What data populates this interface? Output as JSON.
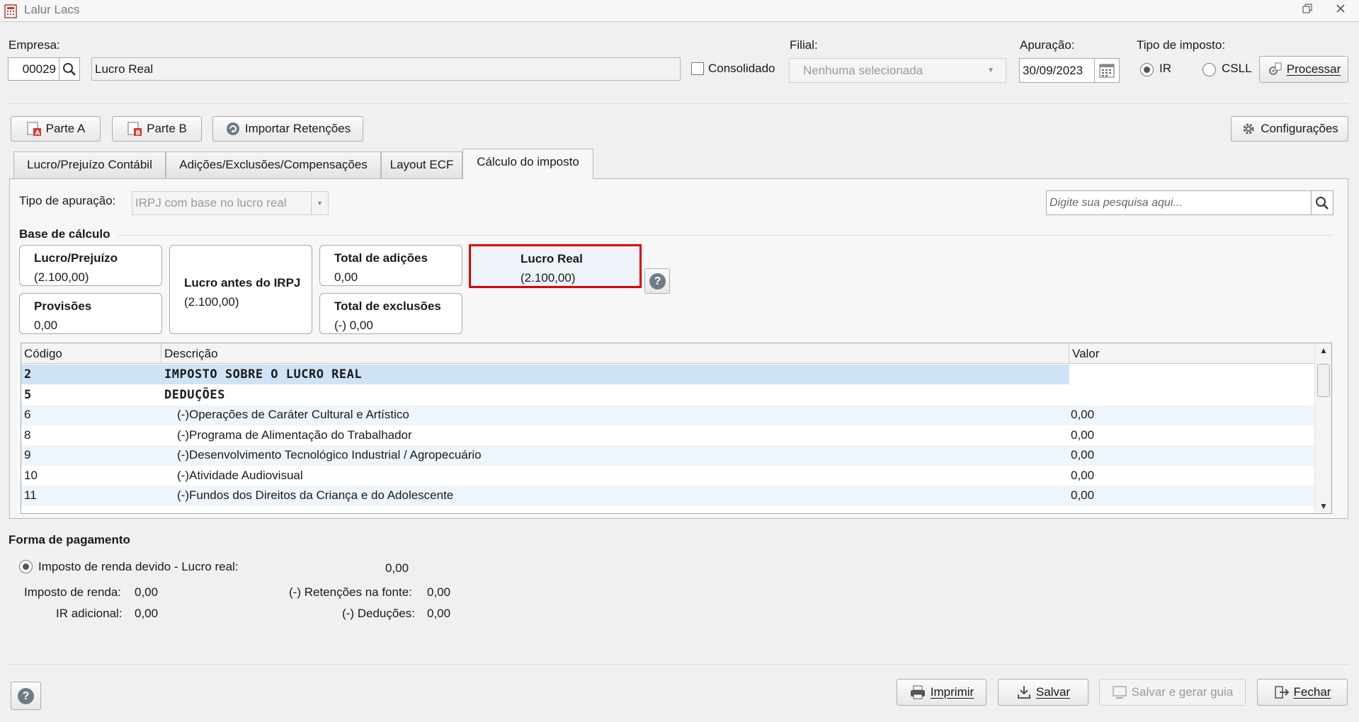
{
  "window": {
    "title": "Lalur Lacs",
    "restore_icon": "restore-window-icon",
    "close_icon": "close-icon"
  },
  "header": {
    "empresa_label": "Empresa:",
    "empresa_code": "00029",
    "empresa_name": "Lucro Real",
    "consolidado_label": "Consolidado",
    "filial_label": "Filial:",
    "filial_value": "Nenhuma selecionada",
    "apuracao_label": "Apuração:",
    "apuracao_value": "30/09/2023",
    "tipo_imposto_label": "Tipo de imposto:",
    "ir_label": "IR",
    "csll_label": "CSLL",
    "selected_tax": "IR",
    "processar_label": "Processar"
  },
  "toolbar": {
    "parte_a": "Parte A",
    "parte_b": "Parte B",
    "importar": "Importar Retenções",
    "configuracoes": "Configurações"
  },
  "tabs": [
    {
      "label": "Lucro/Prejuízo Contábil",
      "active": false
    },
    {
      "label": "Adições/Exclusões/Compensações",
      "active": false
    },
    {
      "label": "Layout ECF",
      "active": false
    },
    {
      "label": "Cálculo do imposto",
      "active": true
    }
  ],
  "calc": {
    "tipo_apuracao_label": "Tipo de apuração:",
    "tipo_apuracao_value": "IRPJ com base no lucro real",
    "search_placeholder": "Digite sua pesquisa aqui...",
    "base_calculo_label": "Base de cálculo",
    "cards": {
      "lucro_prejuizo": {
        "title": "Lucro/Prejuízo",
        "value": "(2.100,00)"
      },
      "provisoes": {
        "title": "Provisões",
        "value": "0,00"
      },
      "lucro_antes": {
        "title": "Lucro antes do IRPJ",
        "value": "(2.100,00)"
      },
      "total_adicoes": {
        "title": "Total de adições",
        "value": "0,00"
      },
      "total_exclusoes": {
        "title": "Total de exclusões",
        "value": "(-) 0,00"
      },
      "lucro_real": {
        "title": "Lucro Real",
        "value": "(2.100,00)"
      }
    }
  },
  "table": {
    "columns": [
      "Código",
      "Descrição",
      "Valor"
    ],
    "rows": [
      {
        "codigo": "2",
        "descricao": "IMPOSTO SOBRE O LUCRO REAL",
        "valor": "",
        "bold": true
      },
      {
        "codigo": "5",
        "descricao": "DEDUÇÕES",
        "valor": "",
        "bold": true
      },
      {
        "codigo": "6",
        "descricao": "(-)Operações de Caráter Cultural e Artístico",
        "valor": "0,00",
        "bold": false
      },
      {
        "codigo": "8",
        "descricao": "(-)Programa de Alimentação do Trabalhador",
        "valor": "0,00",
        "bold": false
      },
      {
        "codigo": "9",
        "descricao": "(-)Desenvolvimento Tecnológico Industrial / Agropecuário",
        "valor": "0,00",
        "bold": false
      },
      {
        "codigo": "10",
        "descricao": "(-)Atividade Audiovisual",
        "valor": "0,00",
        "bold": false
      },
      {
        "codigo": "11",
        "descricao": "(-)Fundos dos Direitos da Criança e do Adolescente",
        "valor": "0,00",
        "bold": false
      }
    ]
  },
  "pagamento": {
    "title": "Forma de pagamento",
    "option_label": "Imposto de renda devido - Lucro real:",
    "option_value": "0,00",
    "imposto_renda_label": "Imposto de renda:",
    "imposto_renda_value": "0,00",
    "ir_adicional_label": "IR adicional:",
    "ir_adicional_value": "0,00",
    "retencoes_label": "(-) Retenções na fonte:",
    "retencoes_value": "0,00",
    "deducoes_label": "(-) Deduções:",
    "deducoes_value": "0,00"
  },
  "footer": {
    "imprimir": "Imprimir",
    "salvar": "Salvar",
    "salvar_gerar": "Salvar e gerar guia",
    "fechar": "Fechar"
  },
  "colors": {
    "highlight_border": "#e00000",
    "selected_row": "#cfe3f7",
    "help_icon": "#6f7b86"
  }
}
